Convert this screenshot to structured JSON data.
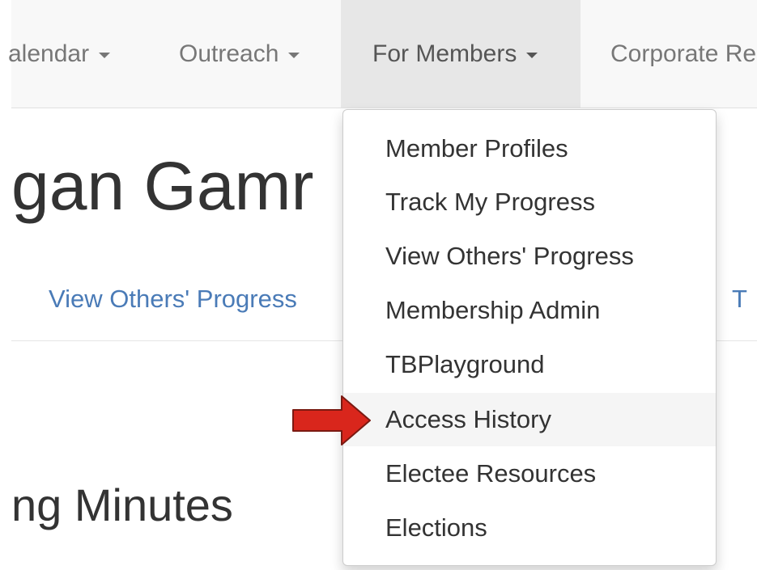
{
  "navbar": {
    "items": [
      {
        "label": "alendar"
      },
      {
        "label": "Outreach"
      },
      {
        "label": "For Members"
      },
      {
        "label": "Corporate Re"
      }
    ]
  },
  "page": {
    "title": "gan Gamr",
    "subnav_left": "View Others' Progress",
    "subnav_right": "T",
    "section_title": "ng Minutes"
  },
  "dropdown": {
    "items": [
      {
        "label": "Member Profiles"
      },
      {
        "label": "Track My Progress"
      },
      {
        "label": "View Others' Progress"
      },
      {
        "label": "Membership Admin"
      },
      {
        "label": "TBPlayground"
      },
      {
        "label": "Access History"
      },
      {
        "label": "Electee Resources"
      },
      {
        "label": "Elections"
      }
    ],
    "highlighted": "Access History"
  },
  "annotation": {
    "icon": "red-arrow-icon",
    "color": "#d9261c"
  },
  "colors": {
    "link": "#4a7bb7",
    "navbar_bg": "#f8f8f8",
    "active_nav_bg": "#e7e7e7"
  }
}
